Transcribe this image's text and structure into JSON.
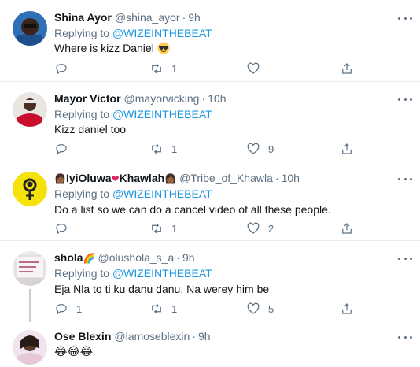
{
  "colors": {
    "text": "#0f1419",
    "secondary": "#5b7083",
    "link": "#1b95e0",
    "border": "#ebeef0"
  },
  "tweets": [
    {
      "name": "Shina Ayor",
      "handle": "@shina_ayor",
      "sep": "·",
      "time": "9h",
      "replying": "Replying to ",
      "mention": "@WIZEINTHEBEAT",
      "text": "Where is kizz Daniel",
      "emoji": "sunglasses-face",
      "counts": {
        "reply": "",
        "retweet": "1",
        "like": ""
      }
    },
    {
      "name": "Mayor Victor",
      "handle": "@mayorvicking",
      "sep": "·",
      "time": "10h",
      "replying": "Replying to ",
      "mention": "@WIZEINTHEBEAT",
      "text": "Kizz daniel too",
      "counts": {
        "reply": "",
        "retweet": "1",
        "like": "9"
      }
    },
    {
      "name_prefix": "👩🏾",
      "name": "IyiOluwa",
      "name_mid": "❤",
      "name_b": "Khawlah",
      "name_suffix": "👩🏾",
      "handle": "@Tribe_of_Khawla",
      "sep": "·",
      "time": "10h",
      "replying": "Replying to ",
      "mention": "@WIZEINTHEBEAT",
      "text": "Do a list so we can do a cancel video of all these people.",
      "counts": {
        "reply": "",
        "retweet": "1",
        "like": "2"
      }
    },
    {
      "name": "shola",
      "name_suffix": "🌈",
      "handle": "@olushola_s_a",
      "sep": "·",
      "time": "9h",
      "replying": "Replying to ",
      "mention": "@WIZEINTHEBEAT",
      "text": "Eja Nla to ti ku danu danu. Na werey him be",
      "counts": {
        "reply": "1",
        "retweet": "1",
        "like": "5"
      }
    },
    {
      "name": "Ose Blexin",
      "handle": "@lamoseblexin",
      "sep": "·",
      "time": "9h",
      "text": "😂😂😂"
    }
  ]
}
